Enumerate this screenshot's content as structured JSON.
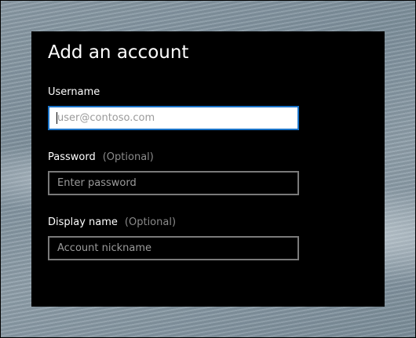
{
  "dialog": {
    "title": "Add an account",
    "username": {
      "label": "Username",
      "placeholder": "user@contoso.com",
      "value": ""
    },
    "password": {
      "label": "Password",
      "optional_label": "(Optional)",
      "placeholder": "Enter password",
      "value": ""
    },
    "display_name": {
      "label": "Display name",
      "optional_label": "(Optional)",
      "placeholder": "Account nickname",
      "value": ""
    }
  },
  "colors": {
    "dialog_background": "#000000",
    "focus_border": "#1a73c8",
    "field_border": "#7a7a7a",
    "optional_text": "#8a8a8a"
  }
}
